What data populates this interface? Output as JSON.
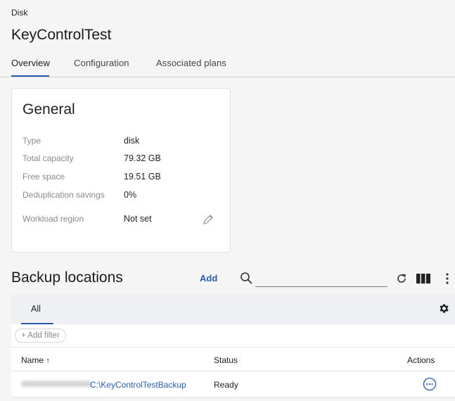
{
  "breadcrumb": "Disk",
  "title": "KeyControlTest",
  "tabs": [
    {
      "label": "Overview"
    },
    {
      "label": "Configuration"
    },
    {
      "label": "Associated plans"
    }
  ],
  "general": {
    "title": "General",
    "properties": [
      {
        "label": "Type",
        "value": "disk"
      },
      {
        "label": "Total capacity",
        "value": "79.32 GB"
      },
      {
        "label": "Free space",
        "value": "19.51 GB"
      },
      {
        "label": "Deduplication savings",
        "value": "0%"
      },
      {
        "label": "Workload region",
        "value": "Not set"
      }
    ]
  },
  "backup_locations": {
    "title": "Backup locations",
    "add_label": "Add",
    "search_placeholder": "",
    "view_tab": "All",
    "add_filter": "+ Add filter",
    "columns": {
      "name": "Name",
      "name_sort": "↑",
      "status": "Status",
      "actions": "Actions"
    },
    "rows": [
      {
        "name": "C:\\KeyControlTestBackup",
        "status": "Ready"
      }
    ]
  },
  "colors": {
    "accent": "#2a5ea8",
    "background": "#f5f5f5"
  }
}
